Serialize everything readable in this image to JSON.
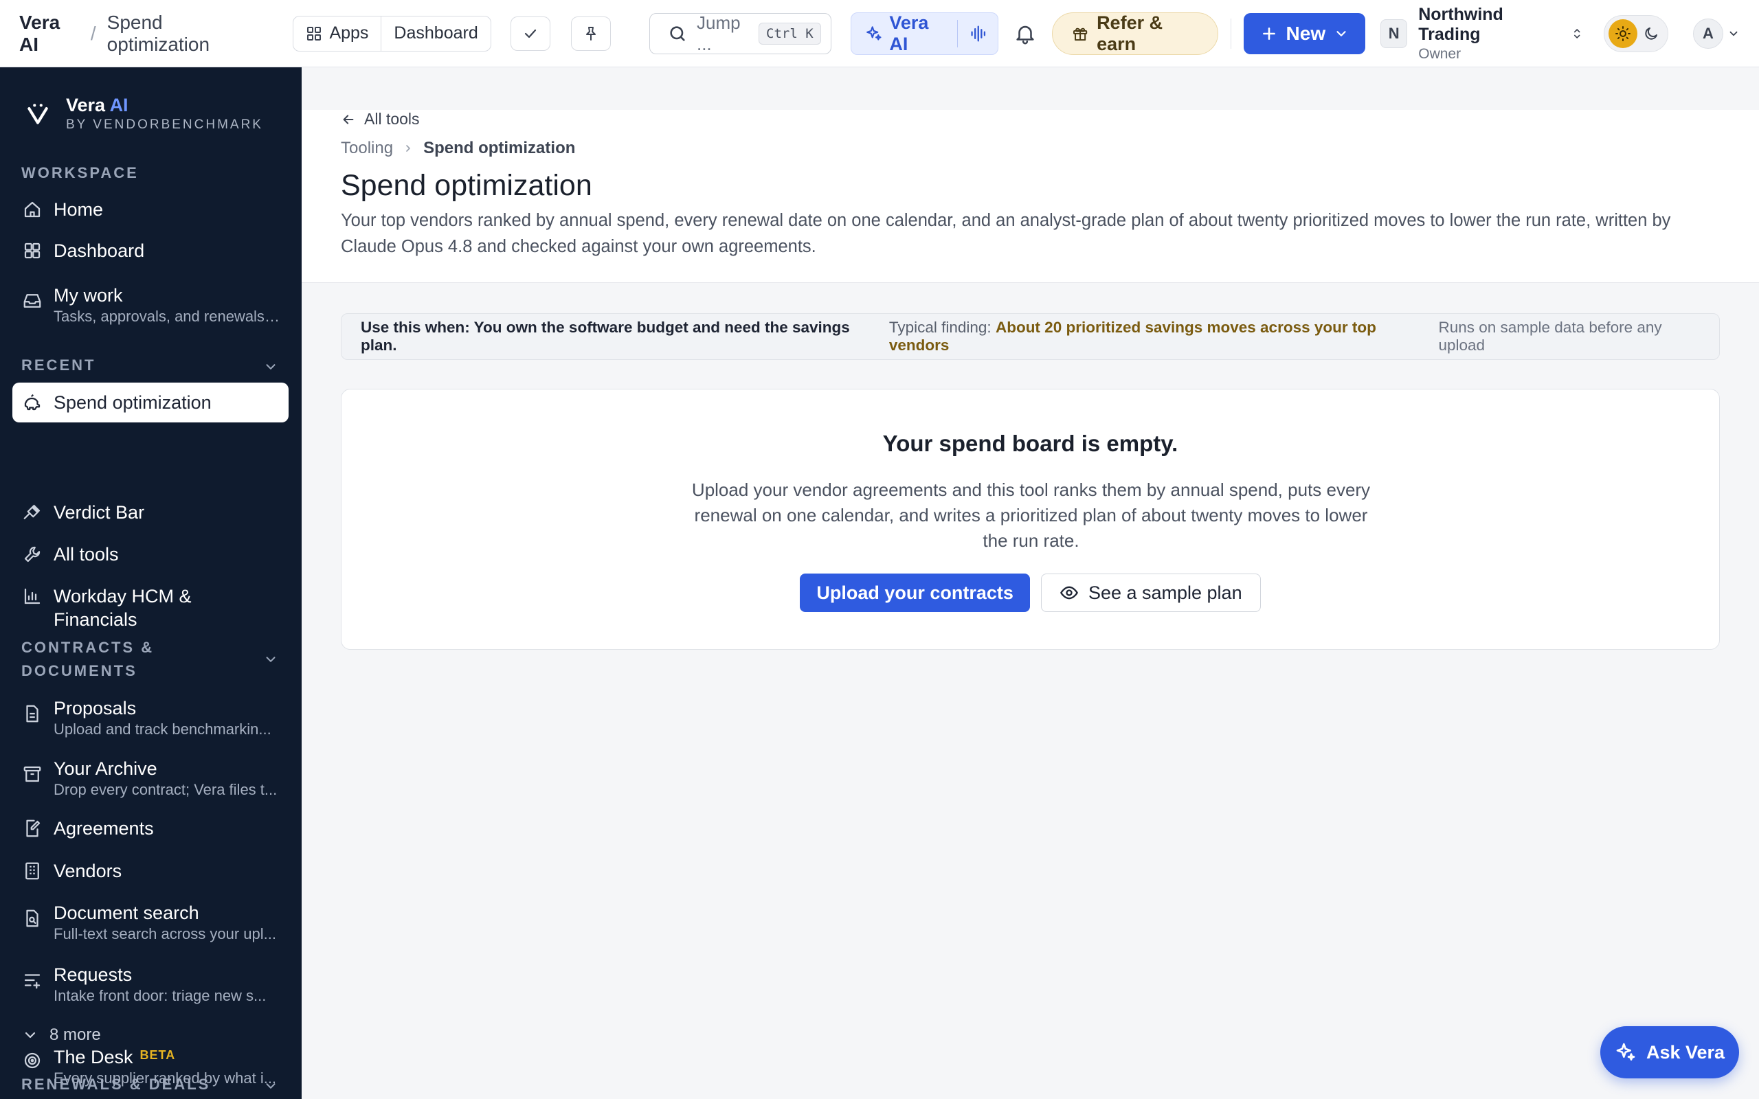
{
  "topbar": {
    "app_name": "Vera AI",
    "separator": "/",
    "page_name": "Spend optimization",
    "apps_label": "Apps",
    "dashboard_label": "Dashboard",
    "search_placeholder": "Jump ...",
    "search_shortcut": "Ctrl K",
    "vera_label": "Vera AI",
    "refer_label": "Refer & earn",
    "new_label": "New",
    "org_initial": "N",
    "org_name": "Northwind Trading",
    "org_role": "Owner",
    "user_initial": "A"
  },
  "sidebar": {
    "brand_name": "Vera",
    "brand_ai": "AI",
    "brand_by": "BY VENDORBENCHMARK",
    "sections": {
      "workspace": "WORKSPACE",
      "recent": "RECENT",
      "contracts": "CONTRACTS & DOCUMENTS",
      "renewals": "RENEWALS & DEALS"
    },
    "workspace_items": [
      {
        "label": "Home"
      },
      {
        "label": "Dashboard"
      },
      {
        "label": "My work",
        "sub": "Tasks, approvals, and renewals ..."
      }
    ],
    "recent_items": [
      {
        "label": "Spend optimization"
      },
      {
        "label": "Verdict Bar"
      },
      {
        "label": "All tools"
      },
      {
        "label": "Workday HCM & Financials"
      }
    ],
    "contracts_items": [
      {
        "label": "Proposals",
        "sub": "Upload and track benchmarkin..."
      },
      {
        "label": "Your Archive",
        "sub": "Drop every contract; Vera files t..."
      },
      {
        "label": "Agreements"
      },
      {
        "label": "Vendors"
      },
      {
        "label": "Document search",
        "sub": "Full-text search across your upl..."
      },
      {
        "label": "Requests",
        "sub": "Intake front door: triage new s..."
      }
    ],
    "more_label": "8 more",
    "renewals_items": [
      {
        "label": "The Desk",
        "badge": "BETA",
        "sub": "Every supplier ranked by what i..."
      }
    ]
  },
  "main": {
    "back_label": "All tools",
    "breadcrumb_parent": "Tooling",
    "breadcrumb_current": "Spend optimization",
    "title": "Spend optimization",
    "description": "Your top vendors ranked by annual spend, every renewal date on one calendar, and an analyst-grade plan of about twenty prioritized moves to lower the run rate, written by Claude Opus 4.8 and checked against your own agreements.",
    "use_when": "Use this when: You own the software budget and need the savings plan.",
    "finding_label": "Typical finding:",
    "finding_value": "About 20 prioritized savings moves across your top vendors",
    "runs_on": "Runs on sample data before any upload",
    "empty_title": "Your spend board is empty.",
    "empty_desc": "Upload your vendor agreements and this tool ranks them by annual spend, puts every renewal on one calendar, and writes a prioritized plan of about twenty moves to lower the run rate.",
    "upload_label": "Upload your contracts",
    "sample_label": "See a sample plan"
  },
  "ask_vera_label": "Ask Vera",
  "colors": {
    "accent": "#2f5be0",
    "sidebar_bg": "#0f1b2e",
    "finding": "#7a5b10"
  }
}
